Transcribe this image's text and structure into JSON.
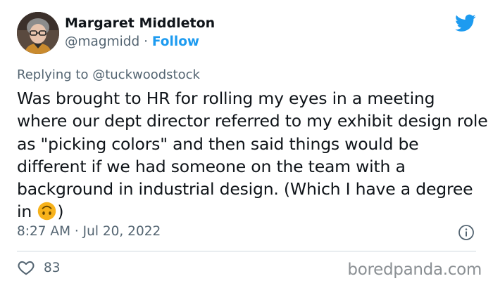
{
  "author": {
    "name": "Margaret Middleton",
    "handle": "@magmidd",
    "separator": "·",
    "follow_label": "Follow"
  },
  "reply": {
    "prefix": "Replying to",
    "mention": "@tuckwoodstock"
  },
  "tweet": {
    "text": "Was brought to HR for rolling my eyes in a meeting where our dept director referred to my exhibit design role as \"picking colors\" and then said things would be different if we had someone on the team with a background in industrial design. (Which I have a degree in",
    "emoji": "upside-down-face-emoji",
    "text_end": ")"
  },
  "timestamp": "8:27 AM · Jul 20, 2022",
  "likes": {
    "count": "83"
  },
  "watermark": "boredpanda.com",
  "icons": {
    "brand": "twitter-bird-icon",
    "info": "info-icon",
    "like": "heart-icon"
  },
  "colors": {
    "accent": "#1d9bf0",
    "text": "#0f1419",
    "secondary": "#536471",
    "divider": "#cfd9de",
    "emoji": "#f7b21b"
  }
}
